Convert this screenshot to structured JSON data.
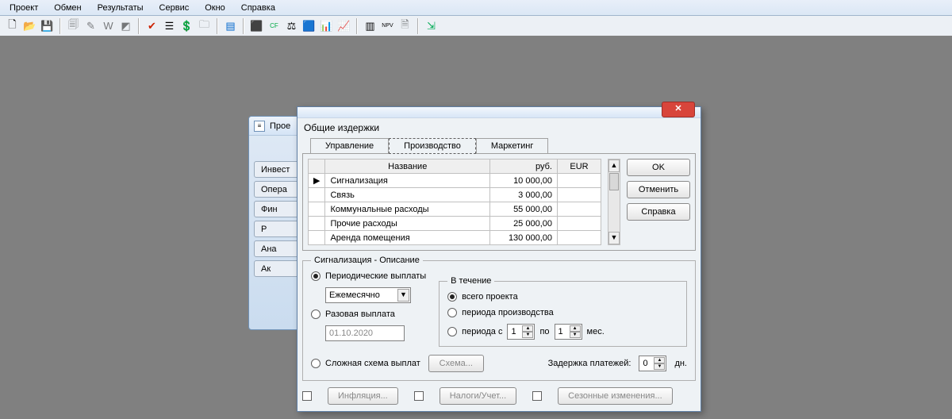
{
  "menu": {
    "items": [
      "Проект",
      "Обмен",
      "Результаты",
      "Сервис",
      "Окно",
      "Справка"
    ]
  },
  "bgwin": {
    "title": "Прое",
    "buttons": [
      "Инвест",
      "Опера",
      "Фин",
      "Р",
      "Ана",
      "Ак"
    ]
  },
  "dialog": {
    "title": "Общие издержки",
    "tabs": {
      "t1": "Управление",
      "t2": "Производство",
      "t3": "Маркетинг",
      "active": 1
    },
    "grid": {
      "headers": {
        "name": "Название",
        "rub": "руб.",
        "eur": "EUR"
      },
      "rows": [
        {
          "name": "Сигнализация",
          "rub": "10 000,00",
          "eur": ""
        },
        {
          "name": "Связь",
          "rub": "3 000,00",
          "eur": ""
        },
        {
          "name": "Коммунальные расходы",
          "rub": "55 000,00",
          "eur": ""
        },
        {
          "name": "Прочие расходы",
          "rub": "25 000,00",
          "eur": ""
        },
        {
          "name": "Аренда помещения",
          "rub": "130 000,00",
          "eur": ""
        }
      ]
    },
    "buttons": {
      "ok": "OK",
      "cancel": "Отменить",
      "help": "Справка"
    },
    "desc": {
      "legend": "Сигнализация - Описание",
      "r_periodic": "Периодические выплаты",
      "combo_period": "Ежемесячно",
      "r_single": "Разовая выплата",
      "single_date": "01.10.2020",
      "r_scheme": "Сложная схема выплат",
      "btn_scheme": "Схема...",
      "duration": {
        "legend": "В течение",
        "r_all": "всего проекта",
        "r_prod": "периода производства",
        "r_range": "периода с",
        "from": "1",
        "to_label": "по",
        "to": "1",
        "suffix": "мес."
      },
      "delay_label": "Задержка платежей:",
      "delay_val": "0",
      "delay_suffix": "дн."
    },
    "bottom": {
      "inflation": "Инфляция...",
      "tax": "Налоги/Учет...",
      "season": "Сезонные изменения..."
    }
  }
}
